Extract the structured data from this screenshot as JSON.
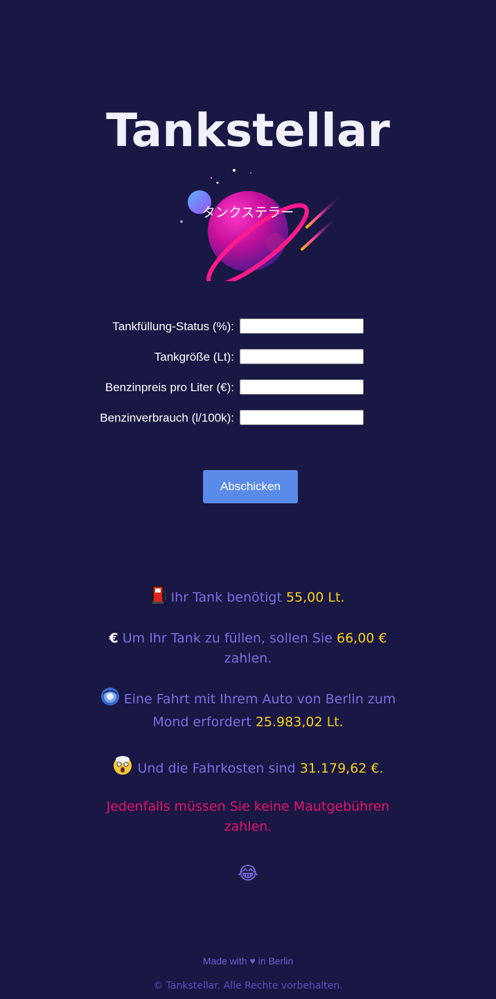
{
  "header": {
    "title": "Tankstellar",
    "subtitle": "タンクステラー",
    "logo_icon": "planet-icon"
  },
  "form": {
    "fields": [
      {
        "label": "Tankfüllung-Status (%):",
        "value": ""
      },
      {
        "label": "Tankgröße (Lt):",
        "value": ""
      },
      {
        "label": "Benzinpreis pro Liter (€):",
        "value": ""
      },
      {
        "label": "Benzinverbrauch (l/100k):",
        "value": ""
      }
    ],
    "submit_label": "Abschicken"
  },
  "results": {
    "tank": {
      "icon": "fuel-pump-icon",
      "text": "Ihr Tank benötigt",
      "value": "55,00 Lt."
    },
    "cost": {
      "icon": "€",
      "text": "Um Ihr Tank zu füllen, sollen Sie",
      "value": "66,00 €",
      "suffix": "zahlen."
    },
    "moon": {
      "icon": "galaxy-icon",
      "text": "Eine Fahrt mit Ihrem Auto von Berlin zum Mond erfordert",
      "value": "25.983,02 Lt."
    },
    "trip_cost": {
      "icon": "shocked-face-icon",
      "text": "Und die Fahrkosten sind",
      "value": "31.179,62 €."
    },
    "toll": "Jedenfalls müssen Sie keine Mautgebühren zahlen.",
    "laugh_emoji": "😂"
  },
  "footer": {
    "made_prefix": "Made with",
    "heart": "♥",
    "made_suffix": "in Berlin",
    "copyright": "© Tankstellar. Alle Rechte vorbehalten."
  },
  "colors": {
    "background": "#191744",
    "accent_purple": "#7c6de0",
    "highlight_yellow": "#f7d21b",
    "warning_pink": "#e8136e",
    "button_blue": "#5b8be8"
  }
}
